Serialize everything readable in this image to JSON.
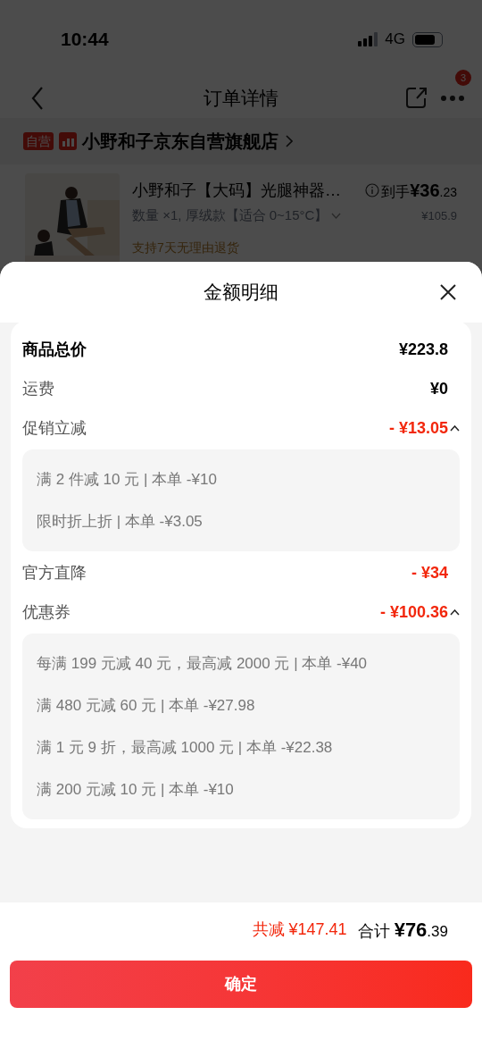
{
  "status_bar": {
    "time": "10:44",
    "network": "4G"
  },
  "nav": {
    "title": "订单详情",
    "badge": "3"
  },
  "store": {
    "badge": "自营",
    "name": "小野和子京东自营旗舰店"
  },
  "product": {
    "kind": "picture",
    "title": "小野和子【大码】光腿神器…",
    "spec": "数量 ×1, 厚绒款【适合 0~15°C】",
    "policy": "支持7天无理由退货",
    "price_label": "到手",
    "price_main": "¥36",
    "price_decimal": ".23",
    "original_price": "¥105.9"
  },
  "sheet": {
    "title": "金额明细",
    "rows": [
      {
        "kind": "bold",
        "label": "商品总价",
        "value": "¥223.8"
      },
      {
        "kind": "plain",
        "label": "运费",
        "value": "¥0"
      },
      {
        "kind": "discount",
        "label": "促销立减",
        "value": "- ¥13.05",
        "expanded": true,
        "details": [
          "满 2 件减 10 元 | 本单 -¥10",
          "限时折上折 | 本单 -¥3.05"
        ]
      },
      {
        "kind": "discount",
        "label": "官方直降",
        "value": "- ¥34"
      },
      {
        "kind": "discount",
        "label": "优惠券",
        "value": "- ¥100.36",
        "expanded": true,
        "details": [
          "每满 199 元减 40 元，最高减 2000 元 | 本单 -¥40",
          "满 480 元减 60 元 | 本单 -¥27.98",
          "满 1 元 9 折，最高减 1000 元 | 本单 -¥22.38",
          "满 200 元减 10 元 | 本单 -¥10"
        ]
      }
    ]
  },
  "footer": {
    "saved": "共减 ¥147.41",
    "total_label": "合计",
    "total_main": "¥76",
    "total_decimal": ".39",
    "button": "确定"
  }
}
